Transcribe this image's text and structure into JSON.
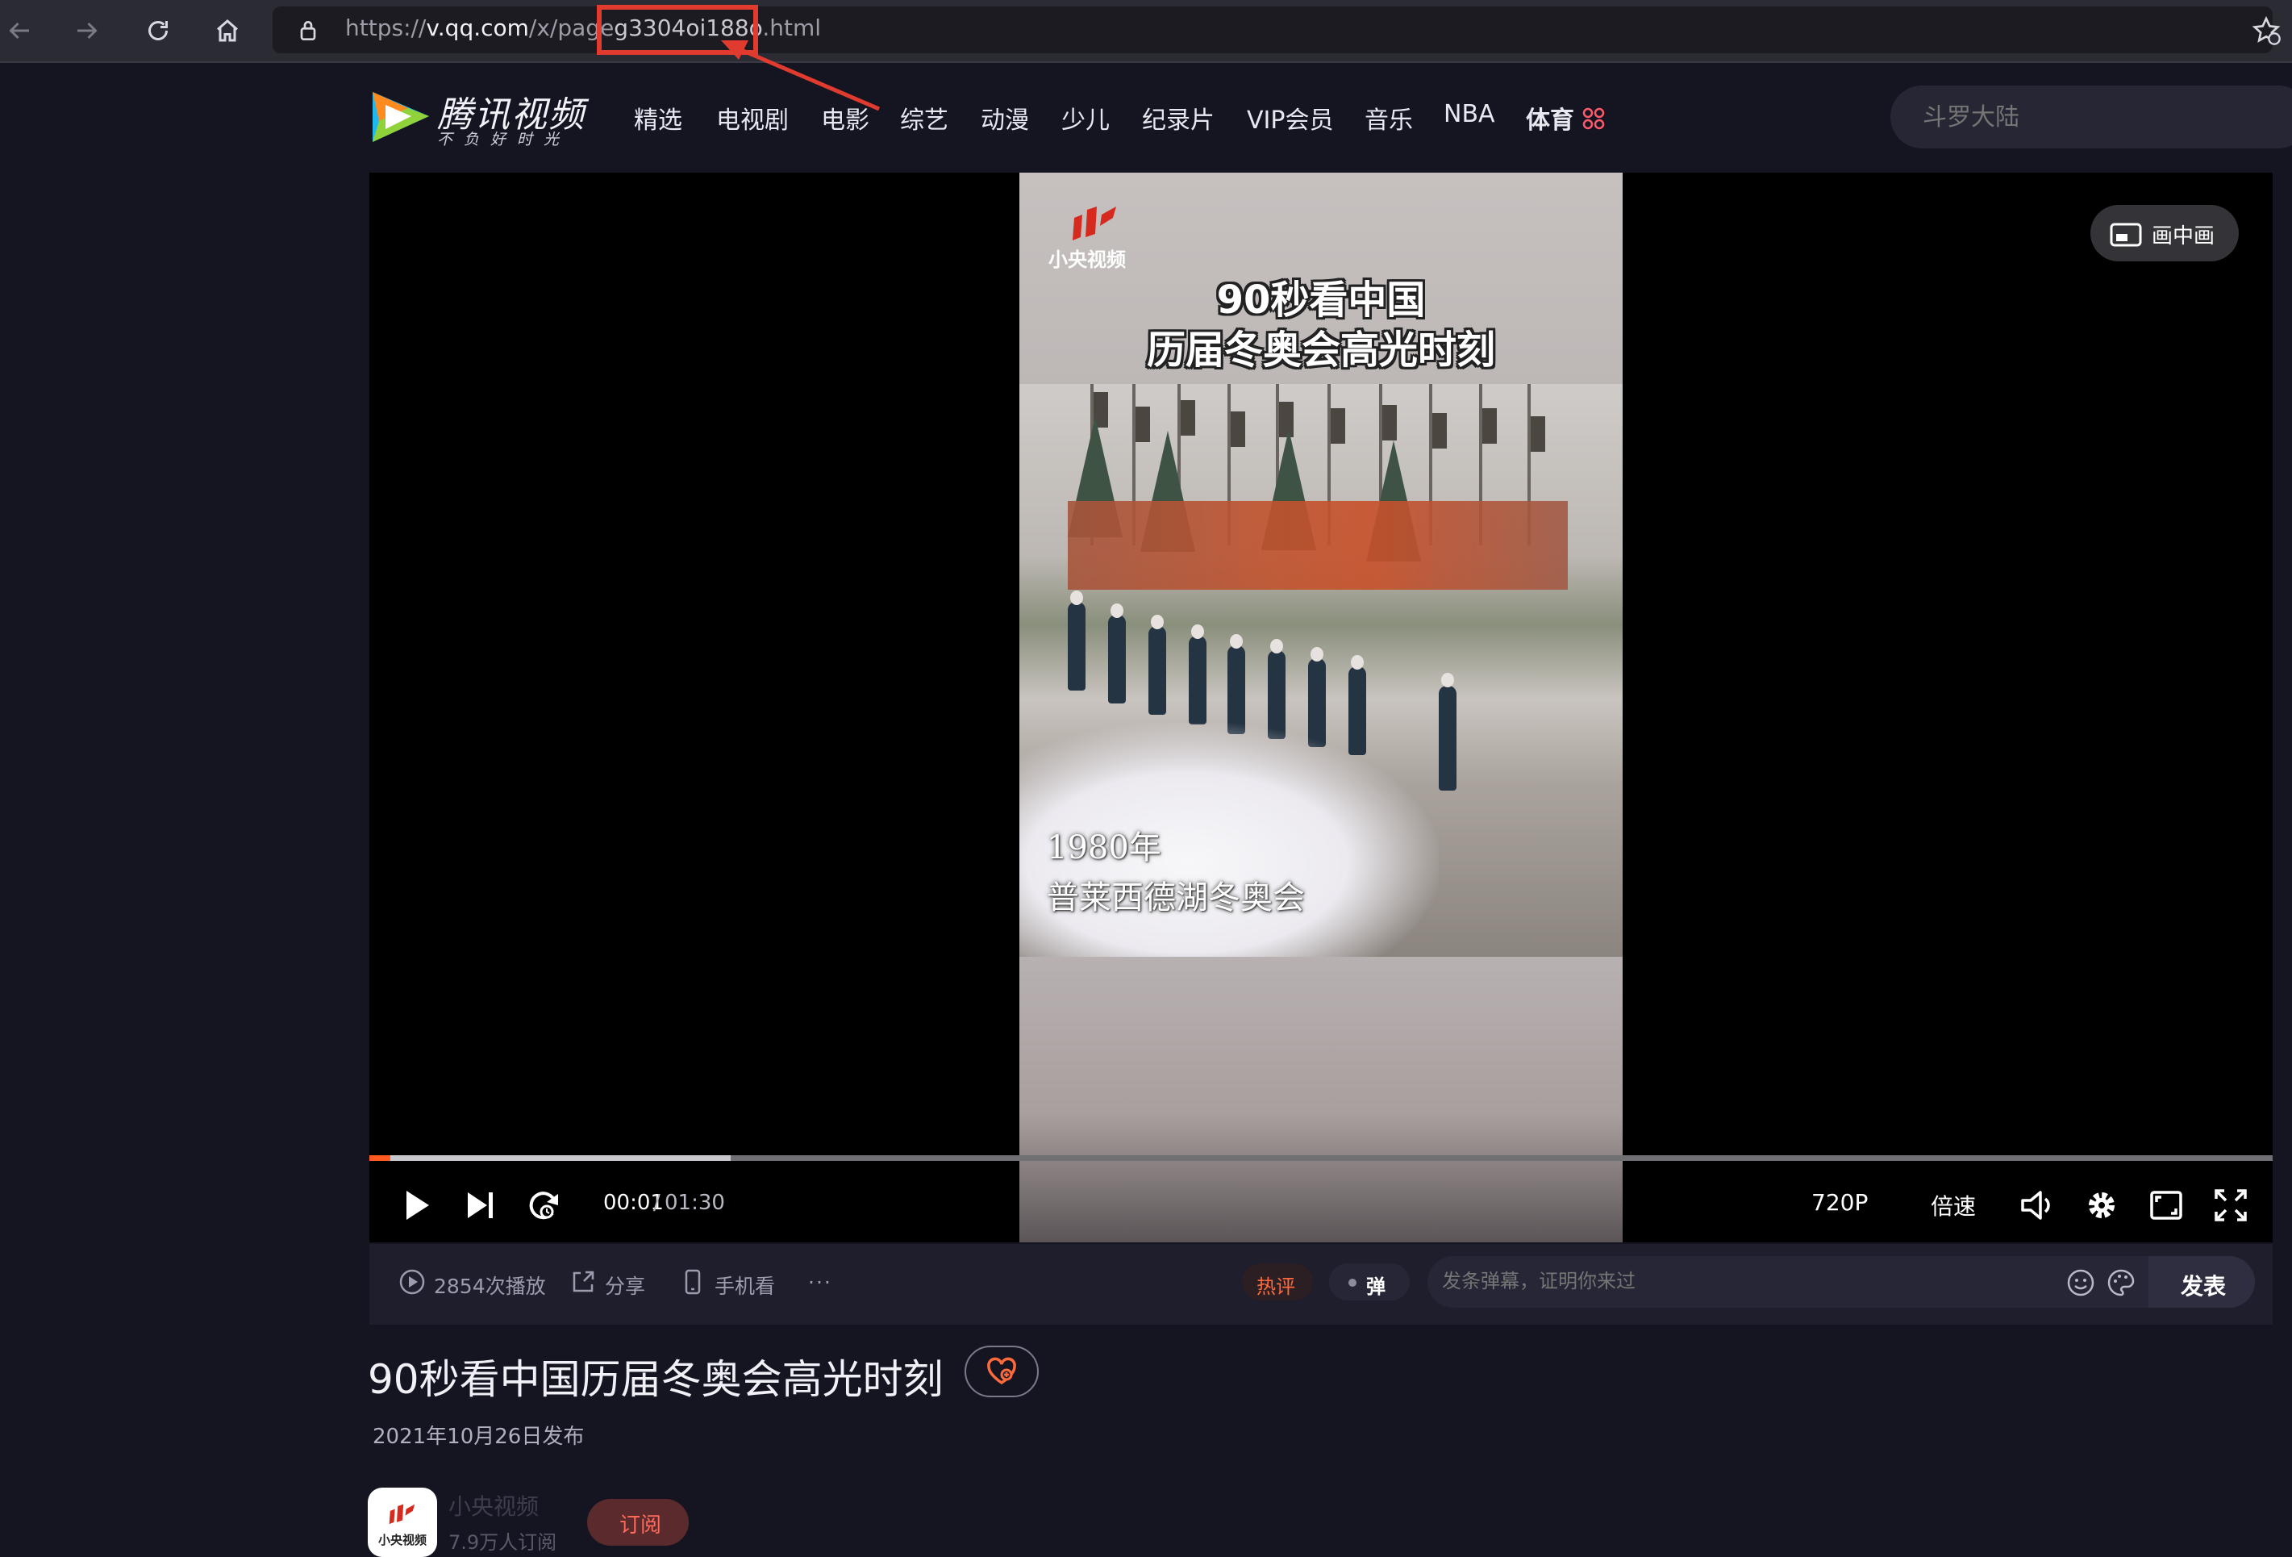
{
  "browser": {
    "url_prefix": "https://",
    "url_host": "v.qq.com",
    "url_path_start": "/x/page",
    "url_highlight": "g3304oi188o",
    "url_end": ".html",
    "icons": [
      "back-arrow-icon",
      "forward-arrow-icon",
      "reload-icon",
      "home-icon",
      "lock-icon",
      "bookmark-star-icon"
    ]
  },
  "site": {
    "logo_main": "腾讯视频",
    "logo_sub": "不负好时光",
    "nav": [
      "精选",
      "电视剧",
      "电影",
      "综艺",
      "动漫",
      "少儿",
      "纪录片",
      "VIP会员",
      "音乐",
      "NBA",
      "体育"
    ],
    "search_placeholder": "斗罗大陆"
  },
  "player": {
    "brand_logo_text": "小央视频",
    "overlay_title_line1": "90秒看中国",
    "overlay_title_line2": "历届冬奥会高光时刻",
    "caption_line1": "1980年",
    "caption_line2": "普莱西德湖冬奥会",
    "pip_label": "画中画",
    "time_current": "00:01",
    "time_separator": "/",
    "time_total": "01:30",
    "progress_played": 0.011,
    "progress_buffered": 0.19,
    "quality": "720P",
    "speed": "倍速",
    "icons": [
      "play-icon",
      "next-icon",
      "loop-icon",
      "volume-icon",
      "settings-icon",
      "web-fullscreen-icon",
      "fullscreen-icon",
      "pip-icon"
    ]
  },
  "infobar": {
    "plays": "2854次播放",
    "share": "分享",
    "mobile": "手机看",
    "more": "···",
    "hot_comments": "热评",
    "danmu_toggle": "弹",
    "danmu_placeholder": "发条弹幕，证明你来过",
    "send": "发表"
  },
  "video_info": {
    "title": "90秒看中国历届冬奥会高光时刻",
    "publish_date": "2021年10月26日发布",
    "channel_name": "小央视频",
    "channel_subscribers": "7.9万人订阅",
    "subscribe": "订阅",
    "avatar_text": "小央视频"
  },
  "colors": {
    "page_bg": "#151522",
    "accent_orange": "#ff5a1f",
    "annotation_red": "#e03b2e",
    "hot_red": "#ff6a3d"
  }
}
